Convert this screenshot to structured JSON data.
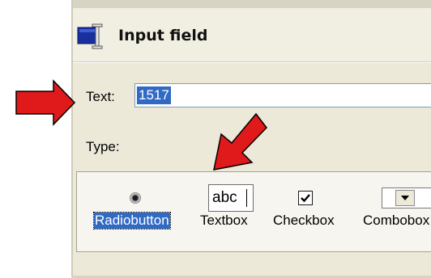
{
  "dialog": {
    "title": "Input field",
    "icon": "input-field-icon"
  },
  "text_row": {
    "label": "Text:",
    "value": "1517"
  },
  "type_row": {
    "label": "Type:"
  },
  "types": [
    {
      "label": "Radiobutton",
      "selected": true,
      "preview": "radio-icon"
    },
    {
      "label": "Textbox",
      "selected": false,
      "preview": "abc",
      "preview_text": "abc"
    },
    {
      "label": "Checkbox",
      "selected": false,
      "preview": "checkbox-icon"
    },
    {
      "label": "Combobox",
      "selected": false,
      "preview": "combobox-icon"
    }
  ],
  "colors": {
    "selection": "#316ac5",
    "annotation_arrow": "#e0191b",
    "dialog_background": "#ece9d8"
  }
}
